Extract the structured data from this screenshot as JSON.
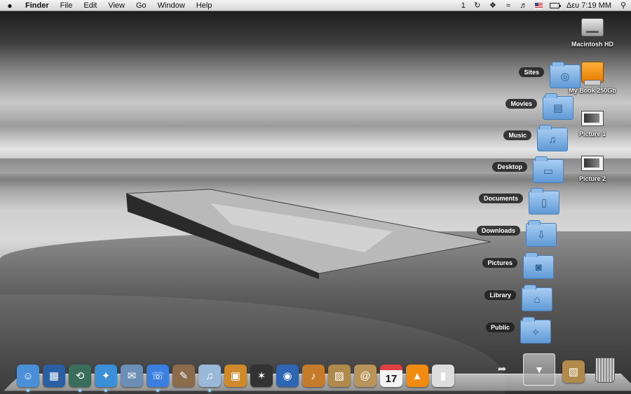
{
  "menubar": {
    "apple_icon": "apple-logo-icon",
    "items": [
      "Finder",
      "File",
      "Edit",
      "View",
      "Go",
      "Window",
      "Help"
    ],
    "status": {
      "one": "1",
      "clock": "Δευ 7:19 MM",
      "icons": [
        "sync-icon",
        "bluetooth-icon",
        "wifi-icon",
        "volume-icon",
        "flag-us-icon",
        "battery-icon",
        "spotlight-icon"
      ]
    }
  },
  "desktop": {
    "icons": [
      {
        "label": "Macintosh HD"
      },
      {
        "label": "My Book 250Gb"
      },
      {
        "label": "Picture 1"
      },
      {
        "label": "Picture 2"
      }
    ]
  },
  "stack": {
    "items": [
      {
        "label": "Sites",
        "glyph": "◎"
      },
      {
        "label": "Movies",
        "glyph": "▤"
      },
      {
        "label": "Music",
        "glyph": "♫"
      },
      {
        "label": "Desktop",
        "glyph": "▭"
      },
      {
        "label": "Documents",
        "glyph": "▯"
      },
      {
        "label": "Downloads",
        "glyph": "⇩"
      },
      {
        "label": "Pictures",
        "glyph": "◙"
      },
      {
        "label": "Library",
        "glyph": "⌂"
      },
      {
        "label": "Public",
        "glyph": "⟡"
      }
    ]
  },
  "dock": {
    "apps": [
      {
        "name": "finder-icon",
        "glyph": "☺",
        "color": "#4a90d9",
        "running": true
      },
      {
        "name": "dashboard-icon",
        "glyph": "▦",
        "color": "#2b5fa3",
        "running": false
      },
      {
        "name": "time-machine-icon",
        "glyph": "⟲",
        "color": "#3a6e5a",
        "running": true
      },
      {
        "name": "safari-icon",
        "glyph": "✦",
        "color": "#3b8fd6",
        "running": true
      },
      {
        "name": "mail-stamp-icon",
        "glyph": "✉",
        "color": "#6d8fb5",
        "running": false
      },
      {
        "name": "ichat-icon",
        "glyph": "☏",
        "color": "#3a7fe0",
        "running": true
      },
      {
        "name": "photo-tools-icon",
        "glyph": "✎",
        "color": "#8a6b4a",
        "running": false
      },
      {
        "name": "itunes-icon",
        "glyph": "♫",
        "color": "#9ab8d8",
        "running": true
      },
      {
        "name": "iphoto-icon",
        "glyph": "▣",
        "color": "#d08a2a",
        "running": false
      },
      {
        "name": "imovie-icon",
        "glyph": "✶",
        "color": "#333333",
        "running": false
      },
      {
        "name": "dvd-player-icon",
        "glyph": "◉",
        "color": "#2f66b3",
        "running": false
      },
      {
        "name": "garageband-icon",
        "glyph": "♪",
        "color": "#c57b2a",
        "running": false
      },
      {
        "name": "preview-icon",
        "glyph": "▨",
        "color": "#b08a4a",
        "running": false
      },
      {
        "name": "address-book-icon",
        "glyph": "@",
        "color": "#b8935a",
        "running": false
      },
      {
        "name": "ical-icon",
        "glyph": "17",
        "color": "#e04040",
        "running": false
      },
      {
        "name": "vlc-icon",
        "glyph": "▲",
        "color": "#f08a10",
        "running": false
      },
      {
        "name": "boot-camp-icon",
        "glyph": "▮",
        "color": "#dddddd",
        "running": false
      }
    ],
    "right": {
      "arrow_glyph": "➦",
      "stack_arrow_glyph": "▼",
      "photos_stack_glyph": "▧"
    }
  }
}
